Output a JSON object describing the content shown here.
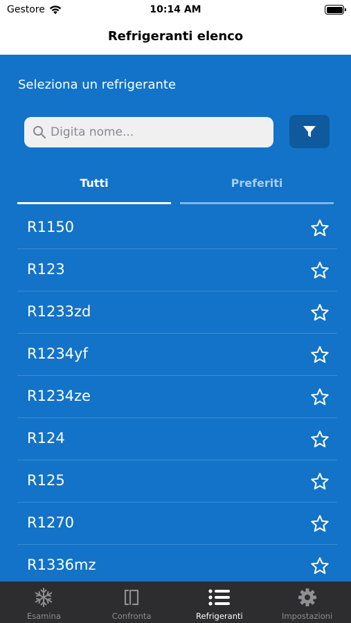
{
  "status": {
    "carrier": "Gestore",
    "time": "10:14 AM"
  },
  "nav": {
    "title": "Refrigeranti elenco"
  },
  "main": {
    "subtitle": "Seleziona un refrigerante",
    "search_placeholder": "Digita nome...",
    "tabs": {
      "all": "Tutti",
      "favorites": "Preferiti"
    },
    "items": [
      "R1150",
      "R123",
      "R1233zd",
      "R1234yf",
      "R1234ze",
      "R124",
      "R125",
      "R1270",
      "R1336mz"
    ]
  },
  "tabbar": {
    "examine": "Esamina",
    "compare": "Confronta",
    "refrigerants": "Refrigeranti",
    "settings": "Impostazioni"
  },
  "colors": {
    "primary": "#1273c8",
    "filter_button": "#0e5a9c",
    "tabbar": "#2d2d2f"
  }
}
